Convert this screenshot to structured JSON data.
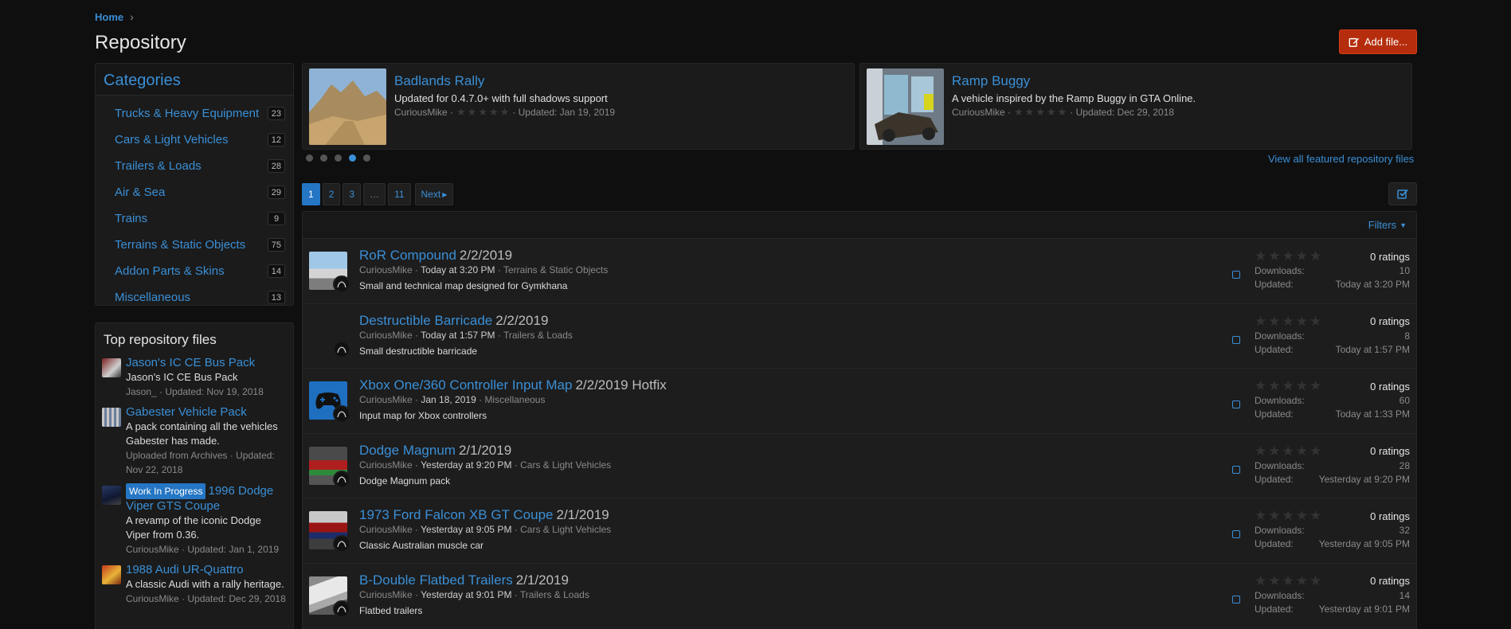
{
  "breadcrumb": {
    "home": "Home",
    "sep": "›"
  },
  "page_title": "Repository",
  "add_file_label": "Add file...",
  "categories": {
    "title": "Categories",
    "items": [
      {
        "label": "Trucks & Heavy Equipment",
        "count": "23"
      },
      {
        "label": "Cars & Light Vehicles",
        "count": "12"
      },
      {
        "label": "Trailers & Loads",
        "count": "28"
      },
      {
        "label": "Air & Sea",
        "count": "29"
      },
      {
        "label": "Trains",
        "count": "9"
      },
      {
        "label": "Terrains & Static Objects",
        "count": "75"
      },
      {
        "label": "Addon Parts & Skins",
        "count": "14"
      },
      {
        "label": "Miscellaneous",
        "count": "13"
      }
    ]
  },
  "top_files": {
    "title": "Top repository files",
    "items": [
      {
        "title": "Jason's IC CE Bus Pack",
        "desc": "Jason's IC CE Bus Pack",
        "meta": "Jason_ · Updated: Nov 19, 2018"
      },
      {
        "title": "Gabester Vehicle Pack",
        "desc": "A pack containing all the vehicles Gabester has made.",
        "meta": "Uploaded from Archives · Updated: Nov 22, 2018"
      },
      {
        "badge": "Work In Progress",
        "title": "1996 Dodge Viper GTS Coupe",
        "desc": "A revamp of the iconic Dodge Viper from 0.36.",
        "meta": "CuriousMike · Updated: Jan 1, 2019"
      },
      {
        "title": "1988 Audi UR-Quattro",
        "desc": "A classic Audi with a rally heritage.",
        "meta": "CuriousMike · Updated: Dec 29, 2018"
      }
    ]
  },
  "featured": [
    {
      "title": "Badlands Rally",
      "desc": "Updated for 0.4.7.0+ with full shadows support",
      "author": "CuriousMike ·",
      "updated": "· Updated: Jan 19, 2019"
    },
    {
      "title": "Ramp Buggy",
      "desc": "A vehicle inspired by the Ramp Buggy in GTA Online.",
      "author": "CuriousMike ·",
      "updated": "· Updated: Dec 29, 2018"
    }
  ],
  "view_all_label": "View all featured repository files",
  "pagination": {
    "pages": [
      "1",
      "2",
      "3",
      "…",
      "11"
    ],
    "next": "Next"
  },
  "filters_label": "Filters",
  "stats_labels": {
    "downloads": "Downloads:",
    "updated": "Updated:"
  },
  "resources": [
    {
      "title": "RoR Compound",
      "version": "2/2/2019",
      "author": "CuriousMike",
      "date": "Today at 3:20 PM",
      "category": "Terrains & Static Objects",
      "desc": "Small and technical map designed for Gymkhana",
      "ratings": "0 ratings",
      "downloads": "10",
      "updated": "Today at 3:20 PM"
    },
    {
      "title": "Destructible Barricade",
      "version": "2/2/2019",
      "author": "CuriousMike",
      "date": "Today at 1:57 PM",
      "category": "Trailers & Loads",
      "desc": "Small destructible barricade",
      "ratings": "0 ratings",
      "downloads": "8",
      "updated": "Today at 1:57 PM"
    },
    {
      "title": "Xbox One/360 Controller Input Map",
      "version": "2/2/2019 Hotfix",
      "author": "CuriousMike",
      "date": "Jan 18, 2019",
      "category": "Miscellaneous",
      "desc": "Input map for Xbox controllers",
      "ratings": "0 ratings",
      "downloads": "60",
      "updated": "Today at 1:33 PM"
    },
    {
      "title": "Dodge Magnum",
      "version": "2/1/2019",
      "author": "CuriousMike",
      "date": "Yesterday at 9:20 PM",
      "category": "Cars & Light Vehicles",
      "desc": "Dodge Magnum pack",
      "ratings": "0 ratings",
      "downloads": "28",
      "updated": "Yesterday at 9:20 PM"
    },
    {
      "title": "1973 Ford Falcon XB GT Coupe",
      "version": "2/1/2019",
      "author": "CuriousMike",
      "date": "Yesterday at 9:05 PM",
      "category": "Cars & Light Vehicles",
      "desc": "Classic Australian muscle car",
      "ratings": "0 ratings",
      "downloads": "32",
      "updated": "Yesterday at 9:05 PM"
    },
    {
      "title": "B-Double Flatbed Trailers",
      "version": "2/1/2019",
      "author": "CuriousMike",
      "date": "Yesterday at 9:01 PM",
      "category": "Trailers & Loads",
      "desc": "Flatbed trailers",
      "ratings": "0 ratings",
      "downloads": "14",
      "updated": "Yesterday at 9:01 PM"
    }
  ]
}
